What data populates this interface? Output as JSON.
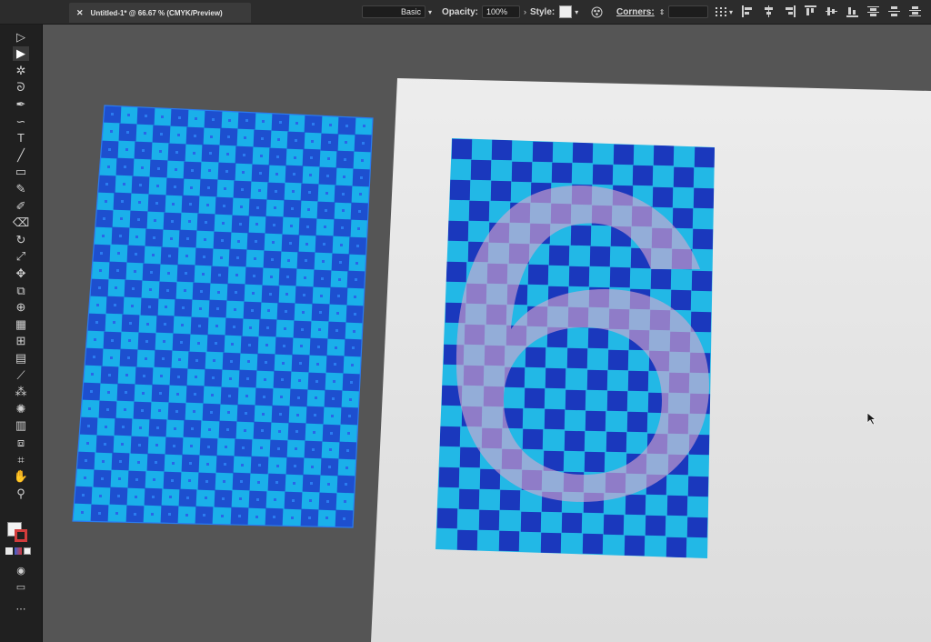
{
  "app": {
    "document_tab": {
      "close_icon": "close-icon",
      "title": "Untitled-1* @ 66.67 % (CMYK/Preview)"
    }
  },
  "control_bar": {
    "brush_preset": "Basic",
    "opacity_label": "Opacity:",
    "opacity_value": "100%",
    "style_label": "Style:",
    "corners_label": "Corners:"
  },
  "tools": [
    "selection-tool",
    "direct-selection-tool",
    "magic-wand-tool",
    "lasso-tool",
    "pen-tool",
    "curvature-tool",
    "type-tool",
    "line-segment-tool",
    "rectangle-tool",
    "paintbrush-tool",
    "shaper-tool",
    "eraser-tool",
    "rotate-tool",
    "scale-tool",
    "puppet-warp-tool",
    "free-transform-tool",
    "shape-builder-tool",
    "perspective-grid-tool",
    "mesh-tool",
    "gradient-tool",
    "eyedropper-tool",
    "blend-tool",
    "symbol-sprayer-tool",
    "column-graph-tool",
    "artboard-tool",
    "slice-tool",
    "hand-tool",
    "zoom-tool"
  ],
  "colors": {
    "checker_light": "#1ab0ea",
    "checker_dark": "#1d4fcf",
    "selection_blue": "#2b7bf0",
    "numeral_overlay": "#d9a6cf",
    "artboard": "#e8e8e8",
    "pasteboard": "#555555"
  },
  "artwork": {
    "numeral": "6"
  }
}
